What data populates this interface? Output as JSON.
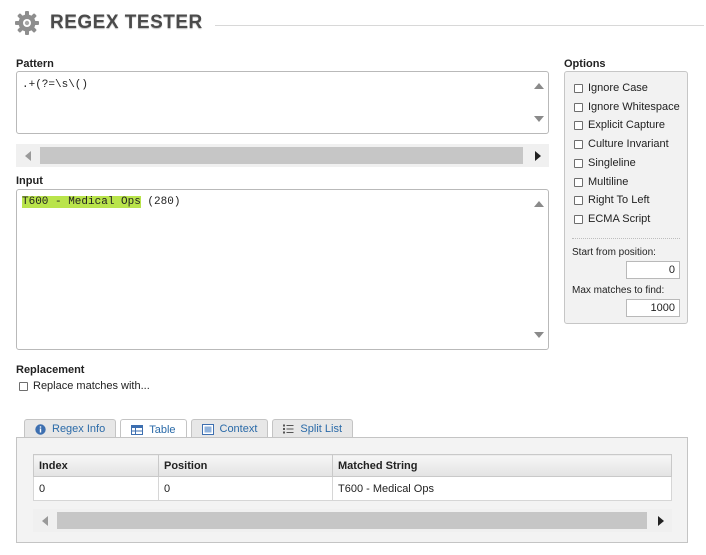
{
  "app": {
    "title": "REGEX TESTER",
    "icon": "gear-icon"
  },
  "pattern": {
    "label": "Pattern",
    "value": ".+(?=\\s\\()"
  },
  "input": {
    "label": "Input",
    "match_text": "T600 - Medical Ops",
    "rest_text": " (280)",
    "highlight_color": "#b9e44b"
  },
  "replacement": {
    "label": "Replacement",
    "checkbox_label": "Replace matches with..."
  },
  "options": {
    "label": "Options",
    "items": [
      {
        "label": "Ignore Case"
      },
      {
        "label": "Ignore Whitespace"
      },
      {
        "label": "Explicit Capture"
      },
      {
        "label": "Culture Invariant"
      },
      {
        "label": "Singleline"
      },
      {
        "label": "Multiline"
      },
      {
        "label": "Right To Left"
      },
      {
        "label": "ECMA Script"
      }
    ],
    "start_from_label": "Start from position:",
    "start_from_value": "0",
    "max_matches_label": "Max matches to find:",
    "max_matches_value": "1000"
  },
  "tabs": [
    {
      "label": "Regex Info",
      "icon": "info-icon"
    },
    {
      "label": "Table",
      "icon": "table-icon",
      "active": true
    },
    {
      "label": "Context",
      "icon": "document-icon"
    },
    {
      "label": "Split List",
      "icon": "list-icon"
    }
  ],
  "results_table": {
    "headers": [
      "Index",
      "Position",
      "Matched String"
    ],
    "rows": [
      [
        "0",
        "0",
        "T600 - Medical Ops"
      ]
    ]
  }
}
